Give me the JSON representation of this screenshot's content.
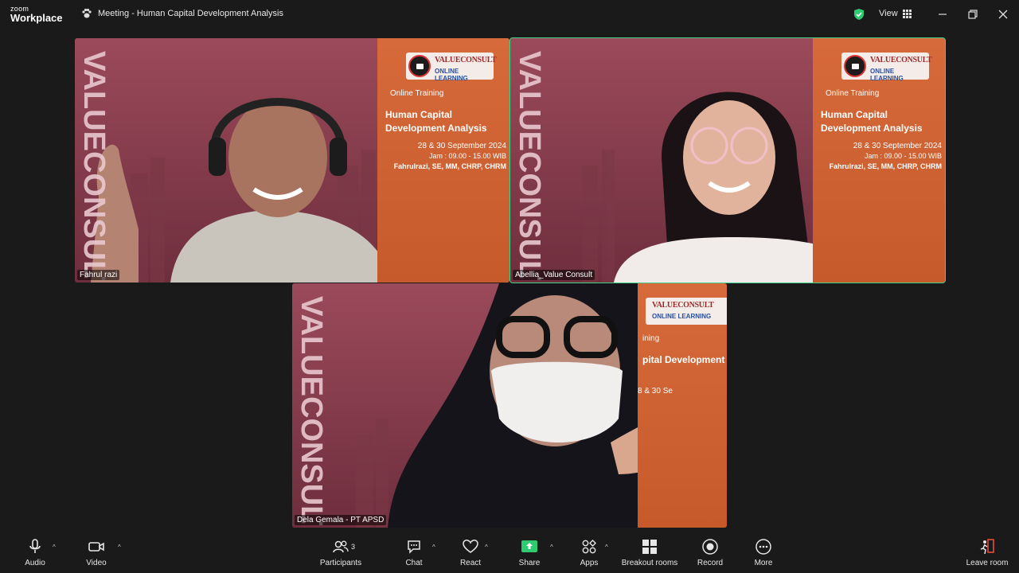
{
  "app": {
    "brand_small": "zoom",
    "brand_big": "Workplace"
  },
  "meeting": {
    "title": "Meeting - Human Capital Development Analysis"
  },
  "header": {
    "view_label": "View"
  },
  "banner": {
    "logo_line1": "VALUECONSULT",
    "logo_line2": "ONLINE LEARNING",
    "online": "Online Training",
    "title": "Human Capital Development Analysis",
    "date": "28 & 30  September 2024",
    "time": "Jam : 09.00 - 15.00 WIB",
    "trainer": "Fahrulrazi, SE, MM, CHRP, CHRM",
    "vertical_text": "VALUECONSULT"
  },
  "tile3_banner": {
    "logo_line1": "VALUECONSULT",
    "logo_line2": "ONLINE LEARNING",
    "online_partial": "ining",
    "title_partial": "pital Development",
    "date_partial": "8 & 30 Se"
  },
  "participants": [
    {
      "name": "Fahrul razi"
    },
    {
      "name": "Abellia_Value Consult"
    },
    {
      "name": "Dela Gemala - PT APSD"
    }
  ],
  "toolbar": {
    "audio": "Audio",
    "video": "Video",
    "participants": "Participants",
    "participants_count": "3",
    "chat": "Chat",
    "react": "React",
    "share": "Share",
    "apps": "Apps",
    "breakout": "Breakout rooms",
    "record": "Record",
    "more": "More",
    "leave": "Leave room"
  },
  "colors": {
    "active_border": "#3fd08a",
    "share_green": "#2ecc71",
    "shield_green": "#2ecc71",
    "banner_orange": "#d76a3a",
    "tile_bg": "#7a3a49"
  }
}
